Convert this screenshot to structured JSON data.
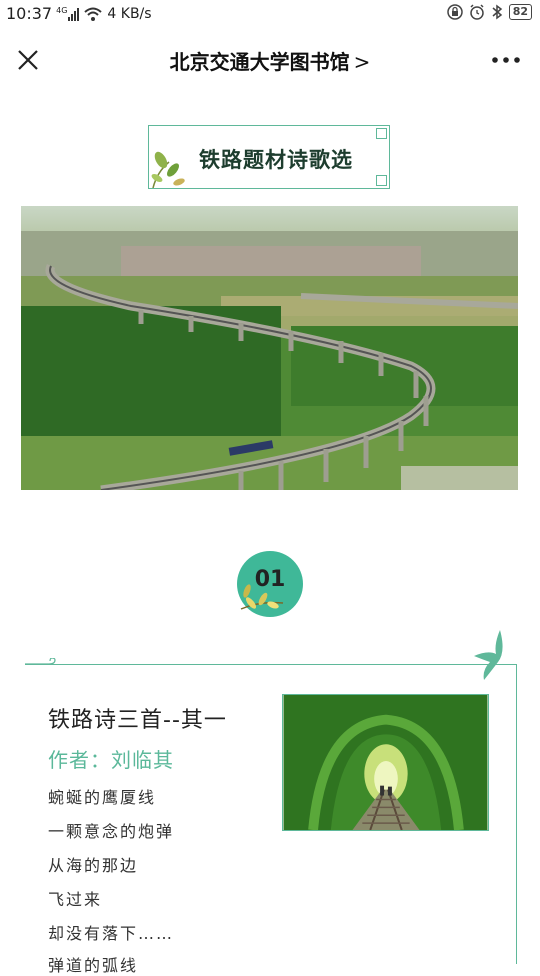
{
  "status_bar": {
    "time": "10:37",
    "network": "4G",
    "speed": "4 KB/s",
    "battery": "82",
    "icons": [
      "signal-icon",
      "wifi-icon",
      "lock-icon",
      "alarm-icon",
      "bluetooth-icon",
      "battery-icon"
    ]
  },
  "nav": {
    "title": "北京交通大学图书馆",
    "title_chevron": ">",
    "close_icon": "close-icon",
    "more_icon": "more-icon"
  },
  "article": {
    "section_title": "铁路题材诗歌选",
    "section_number": "01",
    "poem": {
      "title": "铁路诗三首--其一",
      "author": "作者：刘临其",
      "lines": [
        "蜿蜒的鹰厦线",
        "一颗意念的炮弹",
        "从海的那边",
        "飞过来",
        "却没有落下……",
        "弹道的弧线"
      ]
    }
  },
  "colors": {
    "accent": "#3fb898",
    "frame": "#5fb89a",
    "title_dark": "#1d3d2e"
  }
}
